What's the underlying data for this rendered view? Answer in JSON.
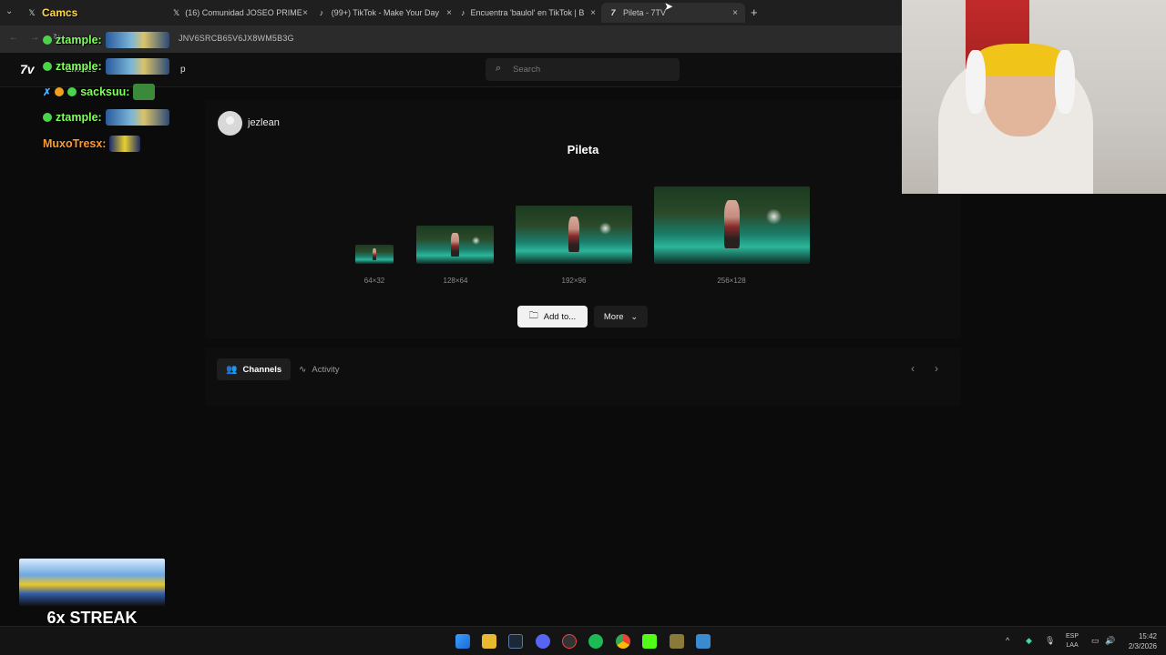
{
  "browser": {
    "tabs": [
      {
        "label": "Camcs",
        "favicon": "x-logo-icon"
      },
      {
        "label": "(16) Comunidad JOSEO PRIME",
        "favicon": "x-logo-icon"
      },
      {
        "label": "(99+) TikTok - Make Your Day",
        "favicon": "tiktok-icon"
      },
      {
        "label": "Encuentra 'baulol' en TikTok | B",
        "favicon": "tiktok-icon"
      },
      {
        "label": "Pileta - 7TV",
        "favicon": "7tv-icon",
        "active": true
      }
    ],
    "new_tab_symbol": "+",
    "close_symbol": "×",
    "url_fragment": "JNV6SRCB65V6JX8WM5B3G"
  },
  "site": {
    "logo": "7v",
    "nav_emotes": "Emotes",
    "nav_partial": "p",
    "search_placeholder": "Search"
  },
  "emote": {
    "owner": "jezlean",
    "name": "Pileta",
    "sizes": [
      "64×32",
      "128×64",
      "192×96",
      "256×128"
    ],
    "add_button": "Add to...",
    "more_button": "More"
  },
  "lower_tabs": {
    "channels": "Channels",
    "activity": "Activity"
  },
  "chat_overlay": {
    "lines": [
      {
        "user": "Camcs:",
        "color": "#ffd84a"
      },
      {
        "user": "ztample:",
        "color": "#7fff5a"
      },
      {
        "user": "ztample:",
        "color": "#7fff5a"
      },
      {
        "user": "sacksuu:",
        "color": "#7fff5a"
      },
      {
        "user": "ztample:",
        "color": "#7fff5a"
      },
      {
        "user": "MuxoTresx:",
        "color": "#ff9a2a"
      }
    ],
    "streak_text": "6x STREAK"
  },
  "taskbar": {
    "language_top": "ESP",
    "language_bottom": "LAA",
    "time": "15:42",
    "date": "2/3/2026"
  }
}
